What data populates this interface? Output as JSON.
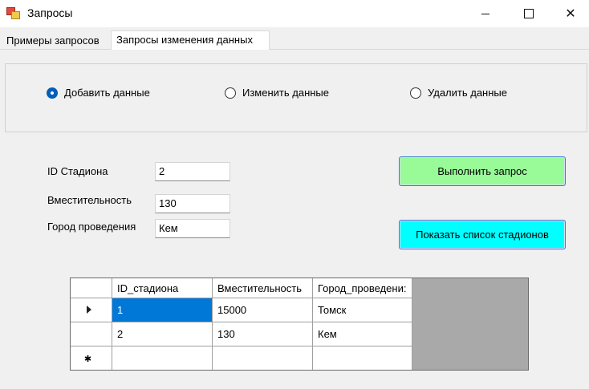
{
  "window": {
    "title": "Запросы"
  },
  "tabs": [
    {
      "label": "Примеры запросов",
      "active": false
    },
    {
      "label": "Запросы изменения данных",
      "active": true
    }
  ],
  "operation": {
    "options": [
      {
        "label": "Добавить данные",
        "checked": true
      },
      {
        "label": "Изменить данные",
        "checked": false
      },
      {
        "label": "Удалить данные",
        "checked": false
      }
    ]
  },
  "form": {
    "stadium_id": {
      "label": "ID Стадиона",
      "value": "2"
    },
    "capacity": {
      "label": "Вместительность",
      "value": "130"
    },
    "city": {
      "label": "Город проведения",
      "value": "Кем"
    }
  },
  "buttons": {
    "execute": {
      "label": "Выполнить запрос",
      "color": "#98fb98"
    },
    "show_list": {
      "label": "Показать список стадионов",
      "color": "#00ffff"
    }
  },
  "grid": {
    "columns": [
      "ID_стадиона",
      "Вместительность",
      "Город_проведени:"
    ],
    "rows": [
      [
        "1",
        "15000",
        "Томск"
      ],
      [
        "2",
        "130",
        "Кем"
      ]
    ],
    "selection_color": "#0078d7"
  }
}
